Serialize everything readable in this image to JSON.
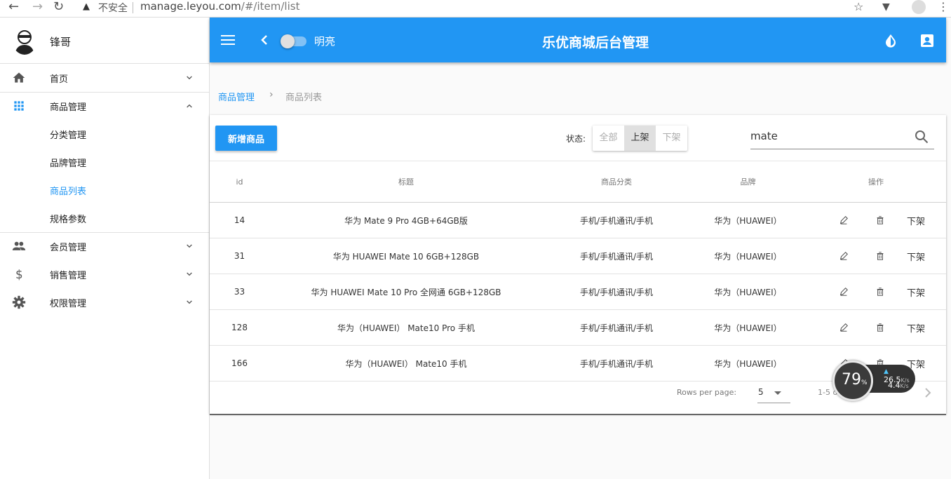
{
  "browser": {
    "insecure_label": "不安全",
    "url_host": "manage.leyou.com",
    "url_path": "/#/item/list"
  },
  "sidebar": {
    "username": "锋哥",
    "items": [
      {
        "label": "首页",
        "icon": "home-icon"
      },
      {
        "label": "商品管理",
        "icon": "apps-icon"
      },
      {
        "label": "会员管理",
        "icon": "people-icon"
      },
      {
        "label": "销售管理",
        "icon": "dollar-icon"
      },
      {
        "label": "权限管理",
        "icon": "settings-icon"
      }
    ],
    "sub_items": [
      {
        "label": "分类管理"
      },
      {
        "label": "品牌管理"
      },
      {
        "label": "商品列表",
        "active": true
      },
      {
        "label": "规格参数"
      }
    ]
  },
  "appbar": {
    "theme_switch_label": "明亮",
    "title": "乐优商城后台管理",
    "color": "#2196f3"
  },
  "breadcrumb": {
    "parent": "商品管理",
    "current": "商品列表"
  },
  "toolbar": {
    "add_label": "新增商品",
    "status_label": "状态:",
    "status_options": [
      "全部",
      "上架",
      "下架"
    ],
    "status_selected": "上架",
    "search_value": "mate"
  },
  "table": {
    "columns": [
      "id",
      "标题",
      "商品分类",
      "品牌",
      "操作"
    ],
    "rows": [
      {
        "id": "14",
        "title": "华为 Mate 9 Pro 4GB+64GB版",
        "category": "手机/手机通讯/手机",
        "brand": "华为（HUAWEI）",
        "action": "下架"
      },
      {
        "id": "31",
        "title": "华为 HUAWEI Mate 10 6GB+128GB",
        "category": "手机/手机通讯/手机",
        "brand": "华为（HUAWEI）",
        "action": "下架"
      },
      {
        "id": "33",
        "title": "华为 HUAWEI Mate 10 Pro 全网通 6GB+128GB",
        "category": "手机/手机通讯/手机",
        "brand": "华为（HUAWEI）",
        "action": "下架"
      },
      {
        "id": "128",
        "title": "华为（HUAWEI） Mate10 Pro 手机",
        "category": "手机/手机通讯/手机",
        "brand": "华为（HUAWEI）",
        "action": "下架"
      },
      {
        "id": "166",
        "title": "华为（HUAWEI） Mate10 手机",
        "category": "手机/手机通讯/手机",
        "brand": "华为（HUAWEI）",
        "action": "下架"
      }
    ]
  },
  "pagination": {
    "rows_per_page_label": "Rows per page:",
    "rows_per_page": "5",
    "range_text": "1-5 of"
  },
  "speed_widget": {
    "percent": "79",
    "percent_unit": "%",
    "upload": "26.5",
    "download": "4.4",
    "unit": "K/s"
  }
}
